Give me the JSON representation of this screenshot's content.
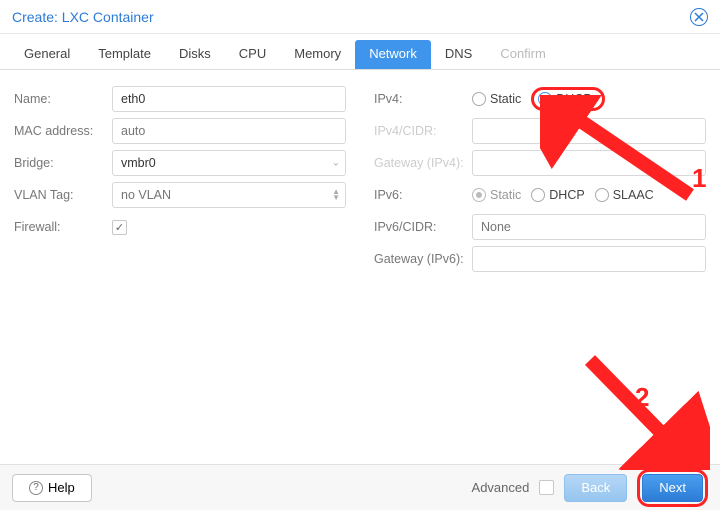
{
  "window": {
    "title": "Create: LXC Container"
  },
  "tabs": [
    "General",
    "Template",
    "Disks",
    "CPU",
    "Memory",
    "Network",
    "DNS",
    "Confirm"
  ],
  "active_tab": "Network",
  "disabled_tab": "Confirm",
  "left": {
    "name_label": "Name:",
    "name_value": "eth0",
    "mac_label": "MAC address:",
    "mac_placeholder": "auto",
    "bridge_label": "Bridge:",
    "bridge_value": "vmbr0",
    "vlan_label": "VLAN Tag:",
    "vlan_placeholder": "no VLAN",
    "firewall_label": "Firewall:",
    "firewall_checked": true
  },
  "right": {
    "ipv4_label": "IPv4:",
    "ipv4_options": [
      "Static",
      "DHCP"
    ],
    "ipv4_selected": "DHCP",
    "ipv4cidr_label": "IPv4/CIDR:",
    "gw4_label": "Gateway (IPv4):",
    "ipv6_label": "IPv6:",
    "ipv6_options": [
      "Static",
      "DHCP",
      "SLAAC"
    ],
    "ipv6_selected": "Static",
    "ipv6cidr_label": "IPv6/CIDR:",
    "ipv6cidr_placeholder": "None",
    "gw6_label": "Gateway (IPv6):"
  },
  "footer": {
    "help": "Help",
    "advanced": "Advanced",
    "advanced_checked": false,
    "back": "Back",
    "next": "Next"
  },
  "annotations": {
    "step1": "1",
    "step2": "2"
  }
}
